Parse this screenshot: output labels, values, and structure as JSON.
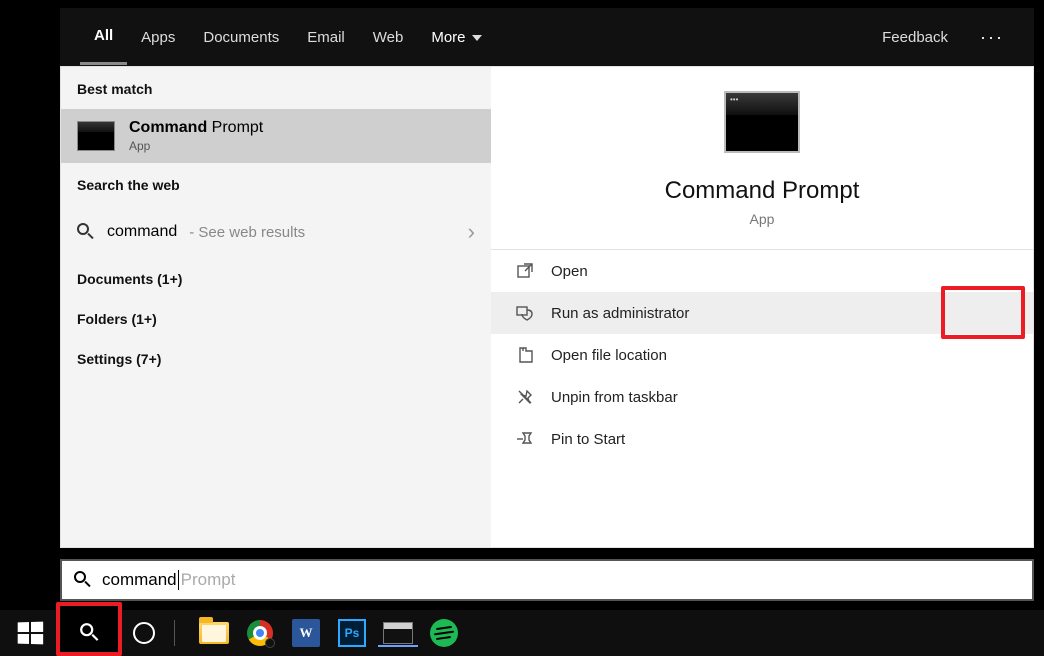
{
  "tabs": {
    "all": "All",
    "apps": "Apps",
    "documents": "Documents",
    "email": "Email",
    "web": "Web",
    "more": "More",
    "feedback": "Feedback"
  },
  "left": {
    "best_match": "Best match",
    "result_title_bold": "Command",
    "result_title_rest": " Prompt",
    "result_sub": "App",
    "search_web": "Search the web",
    "web_term": "command",
    "web_hint": " - See web results",
    "documents": "Documents (1+)",
    "folders": "Folders (1+)",
    "settings": "Settings (7+)"
  },
  "detail": {
    "title": "Command Prompt",
    "sub": "App",
    "actions": {
      "open": "Open",
      "run_admin": "Run as administrator",
      "open_loc": "Open file location",
      "unpin_tb": "Unpin from taskbar",
      "pin_start": "Pin to Start"
    }
  },
  "search": {
    "typed": "command",
    "suggestion": "Prompt"
  }
}
